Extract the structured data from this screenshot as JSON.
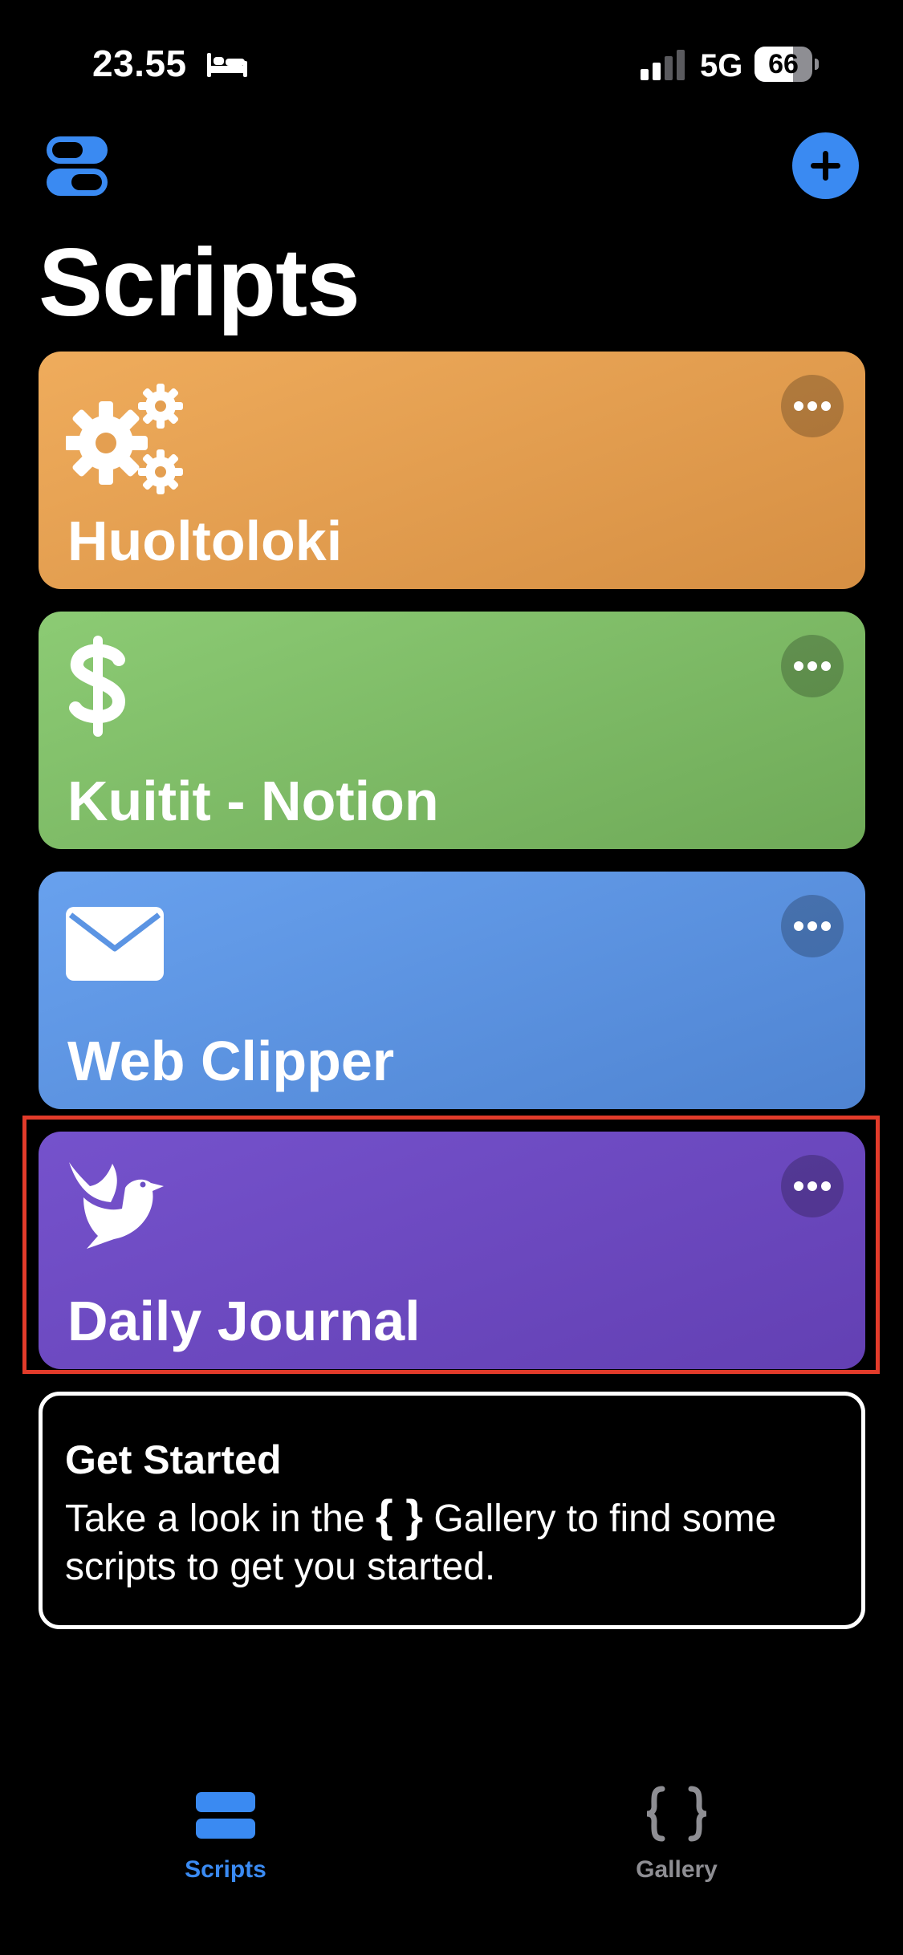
{
  "status_bar": {
    "time": "23.55",
    "network": "5G",
    "battery": "66",
    "battery_level": 0.66
  },
  "header": {
    "title": "Scripts",
    "toggle_icon": "toggle-icon",
    "add_icon": "plus-icon"
  },
  "scripts": [
    {
      "title": "Huoltoloki",
      "icon": "gears-icon",
      "color": "#e9a456"
    },
    {
      "title": "Kuitit - Notion",
      "icon": "dollar-icon",
      "color": "#7fbd6a"
    },
    {
      "title": "Web Clipper",
      "icon": "envelope-icon",
      "color": "#5b94e3"
    },
    {
      "title": "Daily Journal",
      "icon": "bird-icon",
      "color": "#6a4fc4",
      "highlighted": true
    }
  ],
  "get_started": {
    "title": "Get Started",
    "body_before": "Take a look in the ",
    "brace_glyph": "{ }",
    "body_after": " Gallery to find some scripts to get you started."
  },
  "tabs": [
    {
      "label": "Scripts",
      "icon": "scripts-icon",
      "active": true,
      "color": "#3a8af2"
    },
    {
      "label": "Gallery",
      "icon": "braces-icon",
      "active": false,
      "color": "#8e8e93"
    }
  ]
}
